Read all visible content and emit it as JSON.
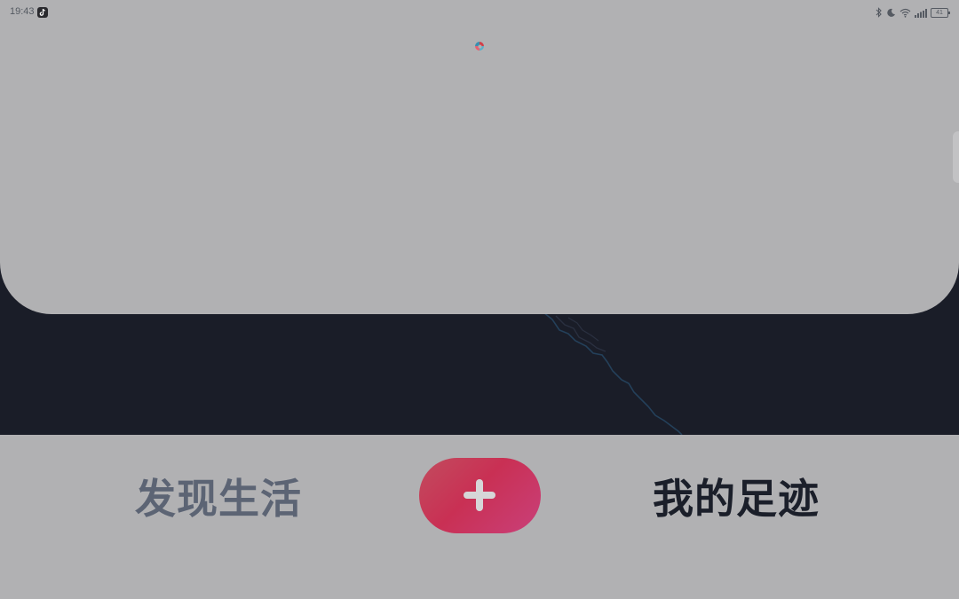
{
  "status_bar": {
    "time": "19:43",
    "app_icon": "tiktok-icon",
    "icons": [
      "bluetooth-icon",
      "moon-icon",
      "wifi-icon",
      "signal-icon"
    ],
    "battery_level": "41"
  },
  "top_panel": {
    "loading_icon": "loading-spinner-icon"
  },
  "bottom_nav": {
    "tab_discover": "发现生活",
    "add_button_icon": "plus-icon",
    "tab_footprint": "我的足迹",
    "active_tab": "我的足迹"
  },
  "colors": {
    "accent": "#c93054",
    "panel": "#b1b1b3",
    "map_background": "#1a1d28",
    "inactive_tab_text": "#5c6474",
    "active_tab_text": "#1b1f2a"
  }
}
